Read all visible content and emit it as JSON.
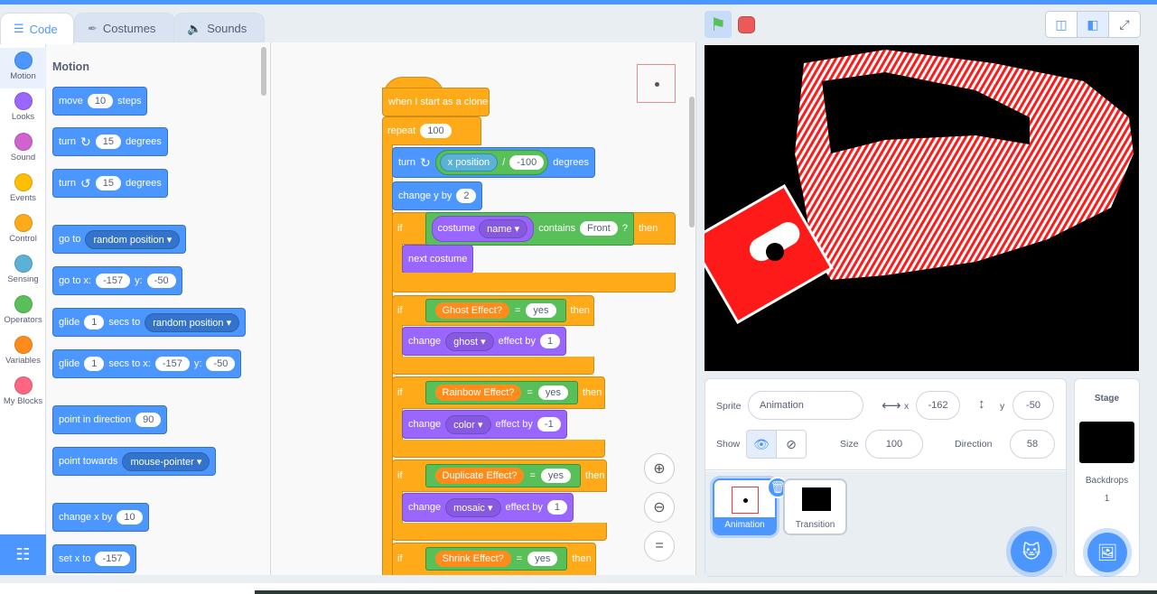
{
  "tabs": [
    {
      "label": "Code",
      "icon": "code-icon"
    },
    {
      "label": "Costumes",
      "icon": "brush-icon"
    },
    {
      "label": "Sounds",
      "icon": "speaker-icon"
    }
  ],
  "categories": [
    {
      "label": "Motion",
      "color": "#4c97ff"
    },
    {
      "label": "Looks",
      "color": "#9966ff"
    },
    {
      "label": "Sound",
      "color": "#cf63cf"
    },
    {
      "label": "Events",
      "color": "#ffbf00"
    },
    {
      "label": "Control",
      "color": "#ffab19"
    },
    {
      "label": "Sensing",
      "color": "#5cb1d6"
    },
    {
      "label": "Operators",
      "color": "#59c059"
    },
    {
      "label": "Variables",
      "color": "#ff8c1a"
    },
    {
      "label": "My Blocks",
      "color": "#ff6680"
    }
  ],
  "palette": {
    "title": "Motion",
    "move": {
      "pre": "move",
      "val": "10",
      "post": "steps"
    },
    "turn_cw": {
      "pre": "turn",
      "val": "15",
      "post": "degrees"
    },
    "turn_ccw": {
      "pre": "turn",
      "val": "15",
      "post": "degrees"
    },
    "goto": {
      "pre": "go to",
      "dd": "random position"
    },
    "gotoxy": {
      "pre": "go to x:",
      "x": "-157",
      "ylab": "y:",
      "y": "-50"
    },
    "glide_to": {
      "pre": "glide",
      "val": "1",
      "mid": "secs to",
      "dd": "random position"
    },
    "glide_xy": {
      "pre": "glide",
      "val": "1",
      "mid": "secs to x:",
      "x": "-157",
      "ylab": "y:",
      "y": "-50"
    },
    "point_dir": {
      "pre": "point in direction",
      "val": "90"
    },
    "point_towards": {
      "pre": "point towards",
      "dd": "mouse-pointer"
    },
    "change_x": {
      "pre": "change x by",
      "val": "10"
    },
    "set_x": {
      "pre": "set x to",
      "val": "-157"
    }
  },
  "script": {
    "hat": "when I start as a clone",
    "repeat": {
      "label": "repeat",
      "val": "100"
    },
    "turn": {
      "label": "turn",
      "rep": "x position",
      "slash": "/",
      "val": "-100",
      "post": "degrees"
    },
    "change_y": {
      "label": "change y by",
      "val": "2"
    },
    "if1": {
      "if": "if",
      "dd_label": "costume",
      "dd": "name",
      "contains": "contains",
      "val": "Front",
      "q": "?",
      "then": "then"
    },
    "next_costume": "next costume",
    "if2": {
      "if": "if",
      "var": "Ghost Effect?",
      "eq": "=",
      "val": "yes",
      "then": "then"
    },
    "change_ghost": {
      "label": "change",
      "dd": "ghost",
      "post": "effect by",
      "val": "1"
    },
    "if3": {
      "if": "if",
      "var": "Rainbow Effect?",
      "eq": "=",
      "val": "yes",
      "then": "then"
    },
    "change_color": {
      "label": "change",
      "dd": "color",
      "post": "effect by",
      "val": "-1"
    },
    "if4": {
      "if": "if",
      "var": "Duplicate Effect?",
      "eq": "=",
      "val": "yes",
      "then": "then"
    },
    "change_mosaic": {
      "label": "change",
      "dd": "mosaic",
      "post": "effect by",
      "val": "1"
    },
    "if5": {
      "if": "if",
      "var": "Shrink Effect?",
      "eq": "=",
      "val": "yes",
      "then": "then"
    }
  },
  "zoom": {
    "in": "+",
    "out": "−",
    "reset": "="
  },
  "sprite_info": {
    "sprite_label": "Sprite",
    "sprite_name": "Animation",
    "x_label": "x",
    "x": "-162",
    "y_label": "y",
    "y": "-50",
    "show_label": "Show",
    "size_label": "Size",
    "size": "100",
    "direction_label": "Direction",
    "direction": "58"
  },
  "sprites": [
    {
      "name": "Animation",
      "selected": true
    },
    {
      "name": "Transition",
      "selected": false
    }
  ],
  "stage_panel": {
    "title": "Stage",
    "backdrops_label": "Backdrops",
    "backdrops_count": "1"
  }
}
